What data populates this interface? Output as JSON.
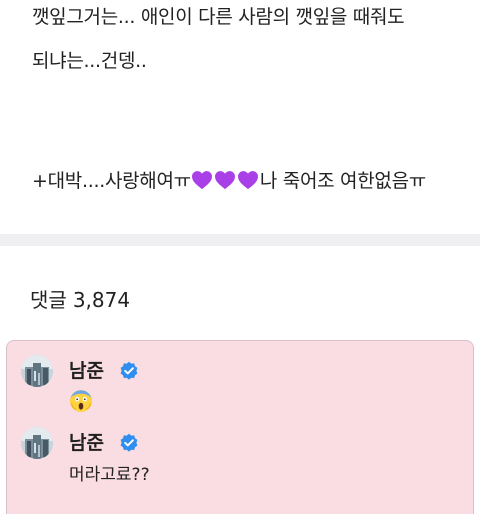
{
  "post": {
    "line1": "깻잎그거는... 애인이 다른 사람의 깻잎을 때줘도",
    "line2": "되냐는...건뎅..",
    "line3_before": "+대박....사랑해여ㅠ",
    "hearts_icon": "purple-heart-icon",
    "hearts_count": 3,
    "heart_color": "#a93fe6",
    "line3_after": "나 죽어조 여한없음ㅠ"
  },
  "comments_section": {
    "label": "댓글",
    "count": "3,874"
  },
  "highlight": {
    "background": "#fadde3",
    "comments": [
      {
        "author": "남준",
        "verified_icon": "verified-badge-icon",
        "emoji_icon": "face-screaming-in-fear-icon",
        "text": ""
      },
      {
        "author": "남준",
        "verified_icon": "verified-badge-icon",
        "text": "머라고료??"
      }
    ]
  },
  "colors": {
    "verified_badge": "#2f8ef0",
    "divider": "#f0f0f3"
  }
}
